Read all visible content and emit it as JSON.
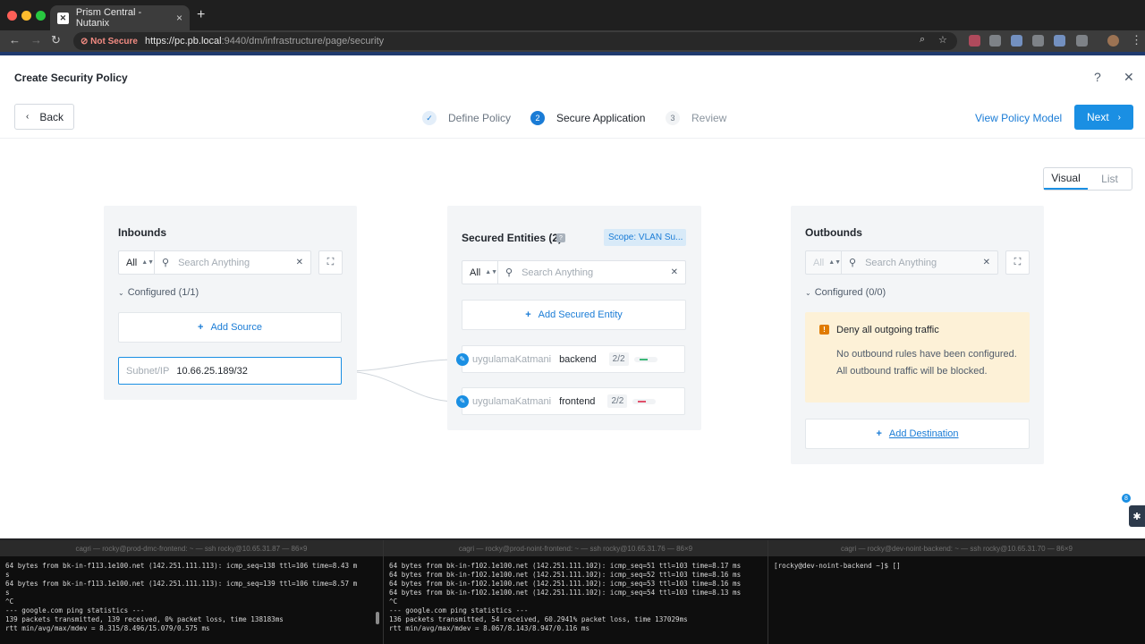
{
  "browser": {
    "tab_title": "Prism Central - Nutanix",
    "new_tab": "+",
    "not_secure": "Not Secure",
    "url_host": "https://pc.pb.local",
    "url_path": ":9440/dm/infrastructure/page/security"
  },
  "header": {
    "title": "Create Security Policy",
    "help": "?",
    "close": "✕"
  },
  "toolbar": {
    "back_label": "Back",
    "steps": [
      {
        "num": "✓",
        "label": "Define Policy",
        "state": "done"
      },
      {
        "num": "2",
        "label": "Secure Application",
        "state": "active"
      },
      {
        "num": "3",
        "label": "Review",
        "state": "todo"
      }
    ],
    "view_model_label": "View Policy Model",
    "next_label": "Next"
  },
  "view_toggle": {
    "visual": "Visual",
    "list": "List"
  },
  "inbounds": {
    "title": "Inbounds",
    "filter": "All",
    "search_placeholder": "Search Anything",
    "configured": "Configured (1/1)",
    "add_label": "Add Source",
    "subnet_key": "Subnet/IP",
    "subnet_value": "10.66.25.189/32"
  },
  "secured": {
    "title": "Secured Entities (2)",
    "scope": "Scope: VLAN Su...",
    "filter": "All",
    "search_placeholder": "Search Anything",
    "add_label": "Add Secured Entity",
    "entities": [
      {
        "category": "uygulamaKatmani",
        "name": "backend",
        "count": "2/2",
        "color": "#3cb878"
      },
      {
        "category": "uygulamaKatmani",
        "name": "frontend",
        "count": "2/2",
        "color": "#e0506a"
      }
    ]
  },
  "outbounds": {
    "title": "Outbounds",
    "filter": "All",
    "search_placeholder": "Search Anything",
    "configured": "Configured (0/0)",
    "warn_title": "Deny all outgoing traffic",
    "warn_body": "No outbound rules have been configured. All outbound traffic will be blocked.",
    "add_label": "Add Destination"
  },
  "float_badge": "8",
  "terminals": [
    {
      "title": "cagri — rocky@prod-dmc-frontend: ~ — ssh rocky@10.65.31.87 — 86×9",
      "lines": "64 bytes from bk-in-f113.1e100.net (142.251.111.113): icmp_seq=138 ttl=106 time=8.43 m\ns\n64 bytes from bk-in-f113.1e100.net (142.251.111.113): icmp_seq=139 ttl=106 time=8.57 m\ns\n^C\n--- google.com ping statistics ---\n139 packets transmitted, 139 received, 0% packet loss, time 138183ms\nrtt min/avg/max/mdev = 8.315/8.496/15.079/0.575 ms"
    },
    {
      "title": "cagri — rocky@prod-noint-frontend: ~ — ssh rocky@10.65.31.76 — 86×9",
      "lines": "64 bytes from bk-in-f102.1e100.net (142.251.111.102): icmp_seq=51 ttl=103 time=8.17 ms\n64 bytes from bk-in-f102.1e100.net (142.251.111.102): icmp_seq=52 ttl=103 time=8.16 ms\n64 bytes from bk-in-f102.1e100.net (142.251.111.102): icmp_seq=53 ttl=103 time=8.16 ms\n64 bytes from bk-in-f102.1e100.net (142.251.111.102): icmp_seq=54 ttl=103 time=8.13 ms\n^C\n--- google.com ping statistics ---\n136 packets transmitted, 54 received, 60.2941% packet loss, time 137029ms\nrtt min/avg/max/mdev = 8.067/8.143/8.947/0.116 ms"
    },
    {
      "title": "cagri — rocky@dev-noint-backend: ~ — ssh rocky@10.65.31.70 — 86×9",
      "lines": "[rocky@dev-noint-backend ~]$ []"
    }
  ]
}
